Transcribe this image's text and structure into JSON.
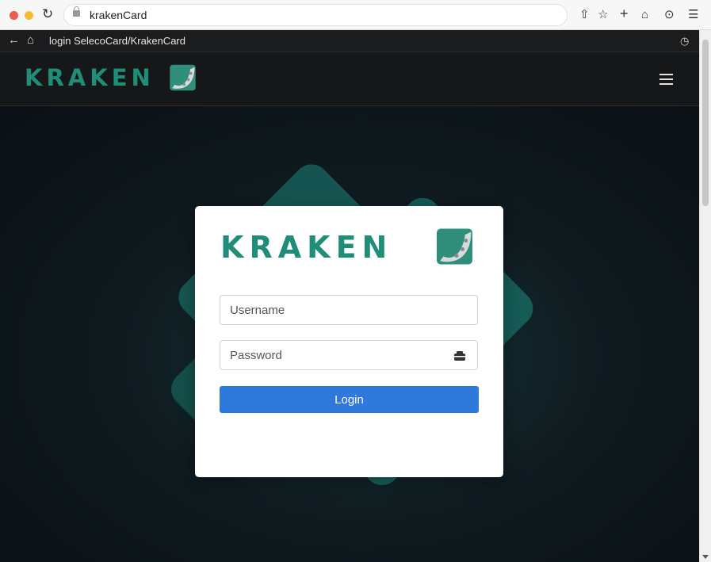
{
  "browser": {
    "url": "krakenCard",
    "page_title": "login SelecoCard/KrakenCard",
    "icons": [
      "close-dot-icon",
      "minimize-dot-icon",
      "reload-icon",
      "lock-icon",
      "share-icon",
      "star-icon",
      "new-tab-icon",
      "home-icon",
      "download-icon",
      "menu-icon",
      "back-icon",
      "home-outline-icon",
      "history-icon"
    ]
  },
  "header": {
    "brand": "KRAKEN",
    "menu_icon": "hamburger-icon"
  },
  "login": {
    "brand": "KRAKEN",
    "username_placeholder": "Username",
    "password_placeholder": "Password",
    "password_icon": "password-visibility-icon",
    "login_label": "Login"
  },
  "colors": {
    "brand": "#1f8d77",
    "button": "#2f79dc",
    "background": "#0f1b20",
    "accent_shape": "#176a63"
  }
}
